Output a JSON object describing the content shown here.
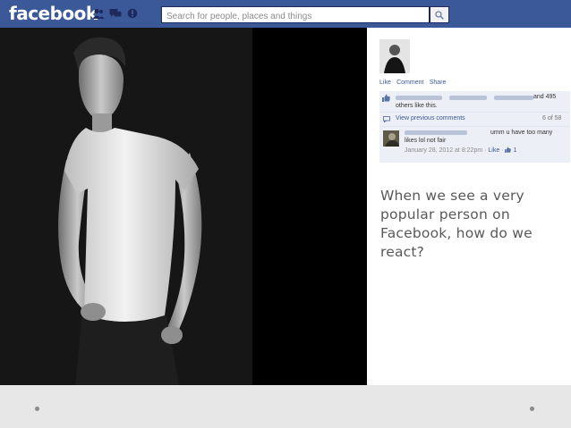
{
  "header": {
    "logo": "facebook",
    "search_placeholder": "Search for people, places and things",
    "brand_color": "#3b5998"
  },
  "post": {
    "actions": {
      "like": "Like",
      "comment": "Comment",
      "share": "Share"
    },
    "likes_text_1": "and 495",
    "likes_text_2": "others like this.",
    "view_previous": "View previous comments",
    "comment_count": "6 of 58",
    "comment_text_1": "umm u have too many",
    "comment_text_2": "likes lol not fair",
    "comment_date": "January 28, 2012 at 8:22pm",
    "comment_like": "Like",
    "comment_likes": "1"
  },
  "slide": {
    "text": "When we see a very popular person on Facebook, how do we react?"
  }
}
